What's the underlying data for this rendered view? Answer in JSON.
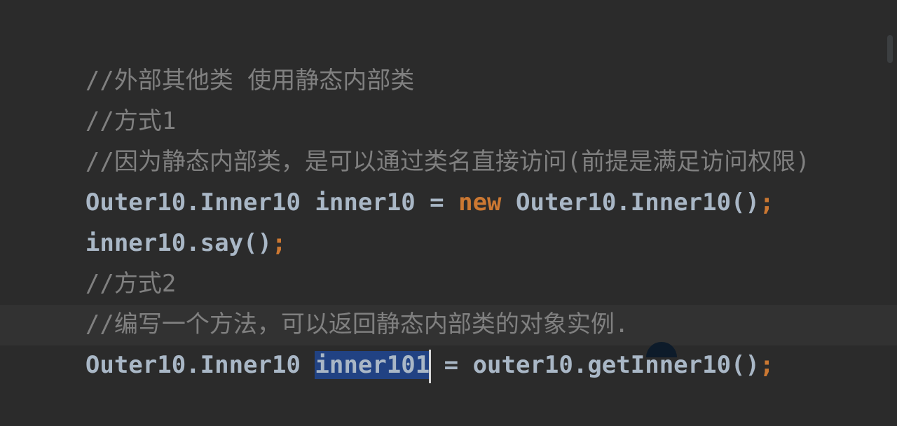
{
  "editor": {
    "lines": {
      "l1": "//外部其他类 使用静态内部类",
      "l2": "//方式1",
      "l3": "//因为静态内部类，是可以通过类名直接访问(前提是满足访问权限)",
      "l4": {
        "a": "Outer10.Inner10 inner10 = ",
        "kw": "new",
        "b": " Outer10.Inner10()",
        "semi": ";"
      },
      "l5": {
        "a": "inner10.say()",
        "semi": ";"
      },
      "l6": "//方式2",
      "l7": "//编写一个方法，可以返回静态内部类的对象实例.",
      "l8": {
        "a": "Outer10.Inner10 ",
        "selected": "inner101",
        "b": " = outer10.getInner10()",
        "semi": ";"
      }
    }
  },
  "colors": {
    "background": "#2b2b2b",
    "comment": "#808080",
    "identifier": "#a9b7c6",
    "keyword": "#cc7832",
    "selection": "#214283"
  }
}
